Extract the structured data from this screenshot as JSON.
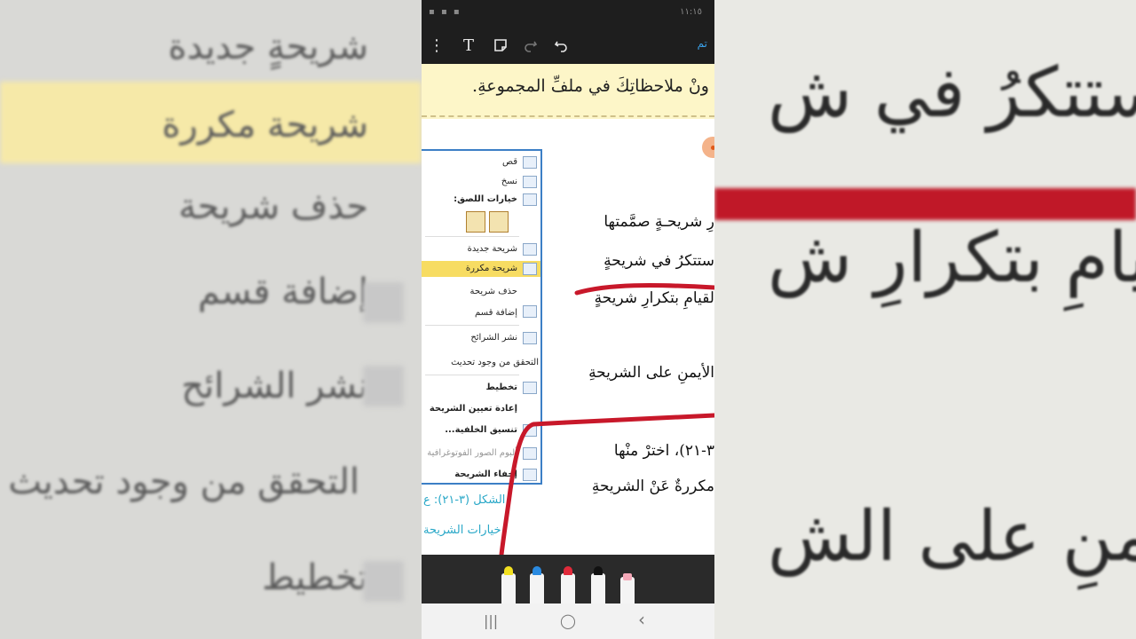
{
  "status_bar": {
    "left_icons": "▪ ▪ ▪",
    "time": "١١:١٥"
  },
  "toolbar": {
    "more_icon": "⋮",
    "text_icon": "T",
    "done_label": "تم"
  },
  "document": {
    "banner_text": "ونْ ملاحظاتِكَ في ملفِّ المجموعةِ.",
    "body_lines": [
      "رِ شريحـةٍ صمَّمتها",
      "ستتكرُ في شريحةٍ",
      "لقيامِ بتكرارِ شريحةٍ",
      "الأيمنِ على الشريحةِ",
      "٣-٢١)، اخترْ منْها",
      "مكررةٌ عَنْ الشريحةِ"
    ],
    "caption_line1": "الشكل (٣-٢١): ع",
    "caption_line2": "خيارات الشريحة"
  },
  "context_menu": {
    "items": [
      {
        "label": "قص",
        "icon": "scissors-icon"
      },
      {
        "label": "نسخ",
        "icon": "copy-icon"
      },
      {
        "label": "خيارات اللصق:",
        "icon": "paste-icon"
      },
      {
        "label": "شريحة جديدة",
        "icon": "new-slide-icon"
      },
      {
        "label": "شريحة مكررة",
        "icon": "duplicate-slide-icon"
      },
      {
        "label": "حذف شريحة",
        "icon": "delete-slide-icon"
      },
      {
        "label": "إضافة قسم",
        "icon": "add-section-icon"
      },
      {
        "label": "نشر الشرائح",
        "icon": "publish-slides-icon"
      },
      {
        "label": "التحقق من وجود تحديث",
        "icon": ""
      },
      {
        "label": "تخطيط",
        "icon": "layout-icon"
      },
      {
        "label": "إعادة تعيين الشريحة",
        "icon": "reset-slide-icon"
      },
      {
        "label": "تنسيق الخلفية...",
        "icon": "format-background-icon"
      },
      {
        "label": "ألبوم الصور الفوتوغرافية",
        "icon": "photo-album-icon"
      },
      {
        "label": "إخفاء الشريحة",
        "icon": "hide-slide-icon"
      }
    ],
    "highlight_color": "#f7dc62"
  },
  "background_left": {
    "lines": [
      "شريحةٍ جديدة",
      "شريحة مكررة",
      "حذف شريحة",
      "إضافة قسم",
      "نشر الشرائح",
      "التحقق من وجود تحديث",
      "تخطيط"
    ]
  },
  "background_right": {
    "lines": [
      "ستتكرُ في ش",
      "لقيامِ بتكرارِ ش",
      "الأيمنِ على الش"
    ]
  },
  "pens": [
    {
      "name": "highlighter-yellow",
      "color": "#f2e020"
    },
    {
      "name": "pen-blue",
      "color": "#2a8ae0"
    },
    {
      "name": "pen-red",
      "color": "#e02a3a"
    },
    {
      "name": "pen-black",
      "color": "#111111"
    },
    {
      "name": "eraser-pink",
      "color": "#f4a8b8"
    }
  ],
  "nav_bar": {
    "recents": "|||",
    "home": "◯",
    "back": "‹"
  },
  "colors": {
    "ink_red": "#c8182a",
    "banner": "#fdf6c8",
    "accent_blue": "#3aa0e8"
  }
}
